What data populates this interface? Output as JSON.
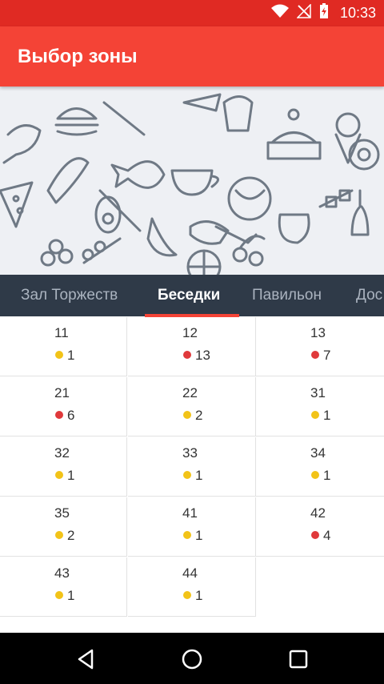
{
  "status": {
    "time": "10:33"
  },
  "appbar": {
    "title": "Выбор зоны"
  },
  "tabs": [
    {
      "label": "Зал Торжеств",
      "active": false
    },
    {
      "label": "Беседки",
      "active": true
    },
    {
      "label": "Павильон",
      "active": false
    },
    {
      "label": "Дос",
      "active": false
    }
  ],
  "colors": {
    "red_dot": "#e0393b",
    "yellow_dot": "#f2c318",
    "accent": "#f44336",
    "tabbar": "#2f3a48"
  },
  "zones": [
    {
      "number": "11",
      "count": "1",
      "status": "yellow"
    },
    {
      "number": "12",
      "count": "13",
      "status": "red"
    },
    {
      "number": "13",
      "count": "7",
      "status": "red"
    },
    {
      "number": "21",
      "count": "6",
      "status": "red"
    },
    {
      "number": "22",
      "count": "2",
      "status": "yellow"
    },
    {
      "number": "31",
      "count": "1",
      "status": "yellow"
    },
    {
      "number": "32",
      "count": "1",
      "status": "yellow"
    },
    {
      "number": "33",
      "count": "1",
      "status": "yellow"
    },
    {
      "number": "34",
      "count": "1",
      "status": "yellow"
    },
    {
      "number": "35",
      "count": "2",
      "status": "yellow"
    },
    {
      "number": "41",
      "count": "1",
      "status": "yellow"
    },
    {
      "number": "42",
      "count": "4",
      "status": "red"
    },
    {
      "number": "43",
      "count": "1",
      "status": "yellow"
    },
    {
      "number": "44",
      "count": "1",
      "status": "yellow"
    }
  ]
}
